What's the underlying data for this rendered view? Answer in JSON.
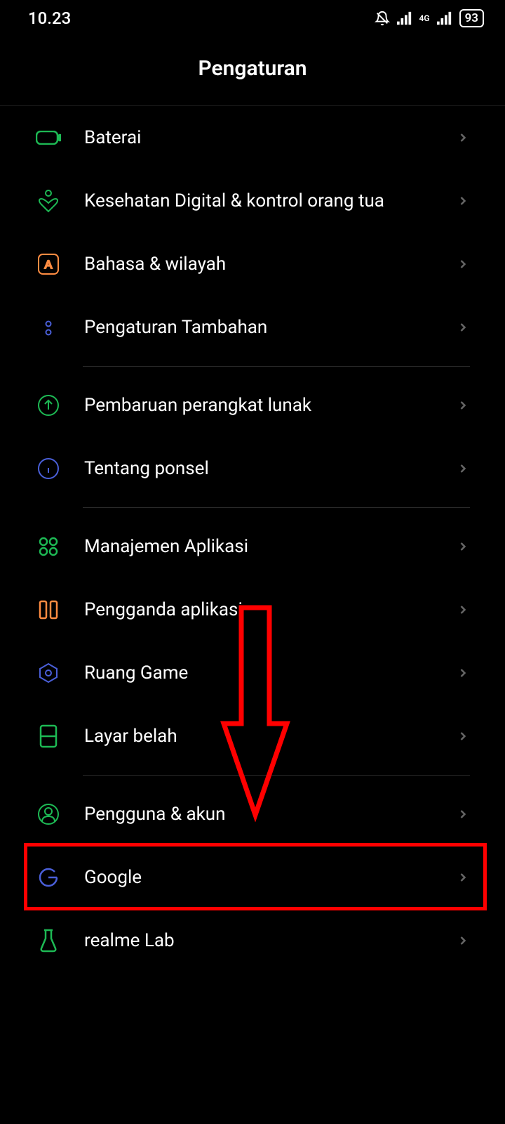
{
  "status_bar": {
    "time": "10.23",
    "battery": "93"
  },
  "header": {
    "title": "Pengaturan"
  },
  "items": [
    {
      "label": "Baterai",
      "icon": "battery"
    },
    {
      "label": "Kesehatan Digital & kontrol orang tua",
      "icon": "heart"
    },
    {
      "label": "Bahasa & wilayah",
      "icon": "language"
    },
    {
      "label": "Pengaturan Tambahan",
      "icon": "dots"
    },
    {
      "label": "Pembaruan perangkat lunak",
      "icon": "update"
    },
    {
      "label": "Tentang ponsel",
      "icon": "info"
    },
    {
      "label": "Manajemen Aplikasi",
      "icon": "apps"
    },
    {
      "label": "Pengganda aplikasi",
      "icon": "clone"
    },
    {
      "label": "Ruang Game",
      "icon": "game"
    },
    {
      "label": "Layar belah",
      "icon": "split"
    },
    {
      "label": "Pengguna & akun",
      "icon": "user"
    },
    {
      "label": "Google",
      "icon": "google"
    },
    {
      "label": "realme Lab",
      "icon": "lab"
    }
  ]
}
